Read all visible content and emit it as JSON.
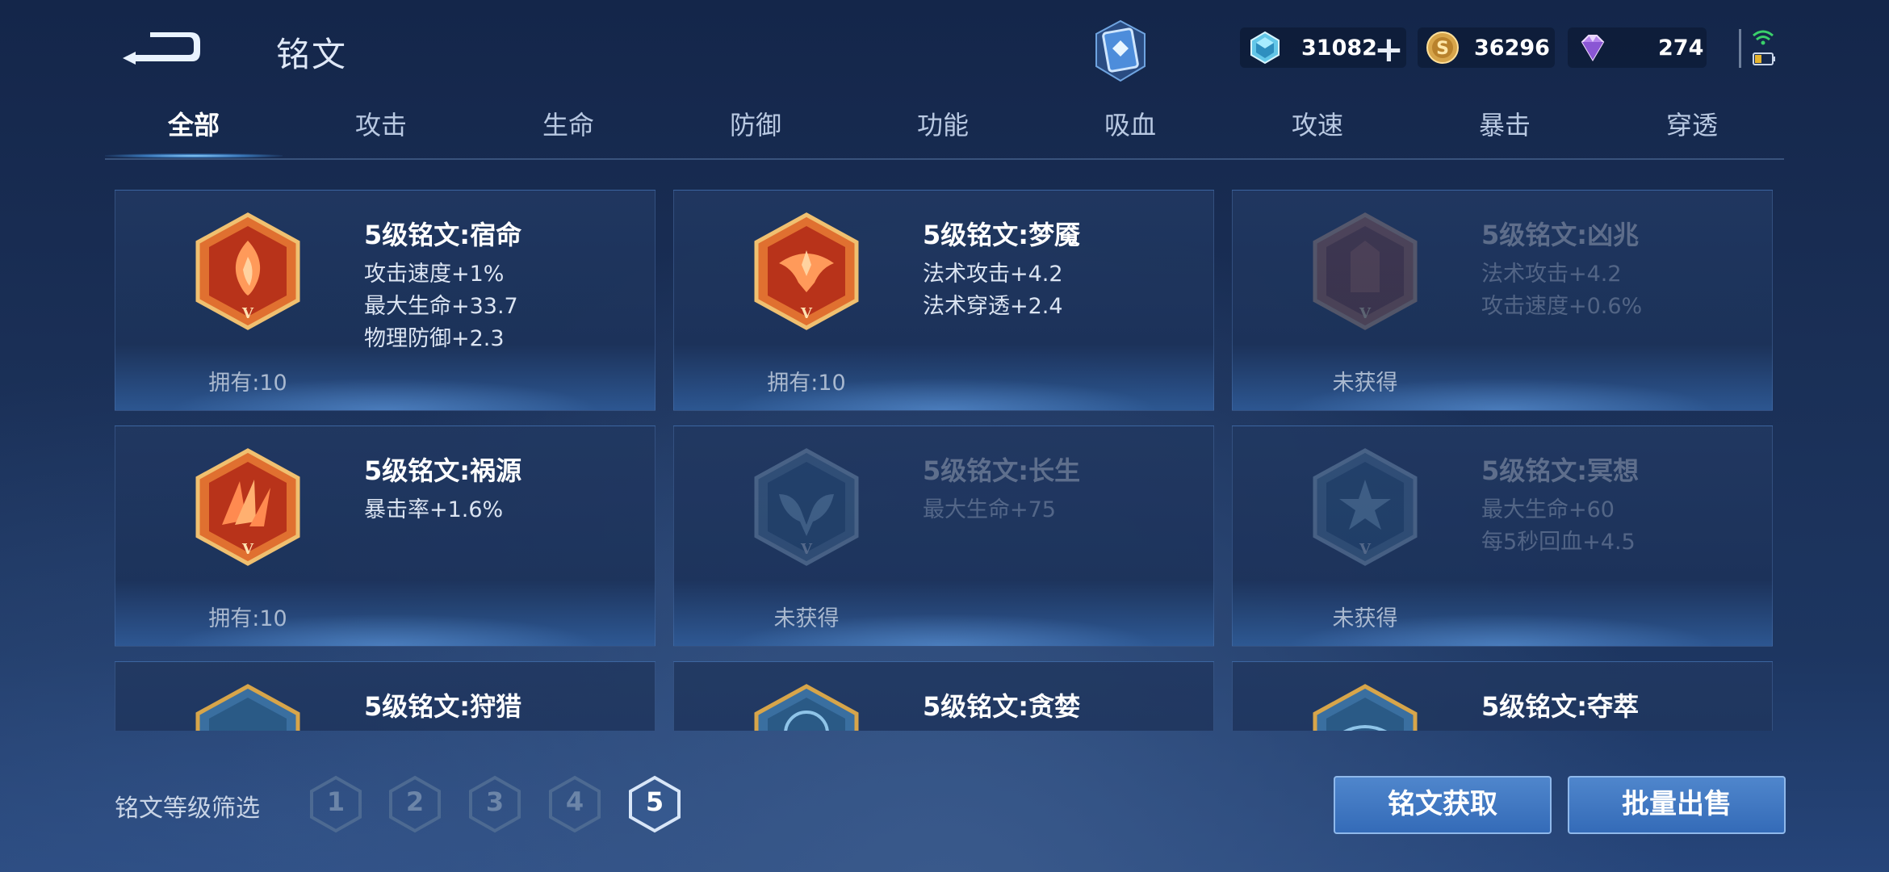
{
  "header": {
    "title": "铭文",
    "currencies": [
      {
        "name": "crystal-currency",
        "value": "31082",
        "icon": "crystal-icon",
        "has_plus": true
      },
      {
        "name": "gold-currency",
        "value": "36296",
        "icon": "gold-coin-icon",
        "has_plus": false
      },
      {
        "name": "diamond-currency",
        "value": "274",
        "icon": "diamond-icon",
        "has_plus": false
      }
    ],
    "plus_symbol": "+"
  },
  "tabs": [
    "全部",
    "攻击",
    "生命",
    "防御",
    "功能",
    "吸血",
    "攻速",
    "暴击",
    "穿透"
  ],
  "active_tab": "全部",
  "runes": [
    {
      "name": "5级铭文:宿命",
      "stats": [
        "攻击速度+1%",
        "最大生命+33.7",
        "物理防御+2.3"
      ],
      "owned": "拥有:10",
      "locked": false,
      "color": "#c8401c"
    },
    {
      "name": "5级铭文:梦魇",
      "stats": [
        "法术攻击+4.2",
        "法术穿透+2.4"
      ],
      "owned": "拥有:10",
      "locked": false,
      "color": "#c8401c"
    },
    {
      "name": "5级铭文:凶兆",
      "stats": [
        "法术攻击+4.2",
        "攻击速度+0.6%"
      ],
      "owned": "未获得",
      "locked": true,
      "color": "#a03a2a"
    },
    {
      "name": "5级铭文:祸源",
      "stats": [
        "暴击率+1.6%"
      ],
      "owned": "拥有:10",
      "locked": false,
      "color": "#c8401c"
    },
    {
      "name": "5级铭文:长生",
      "stats": [
        "最大生命+75"
      ],
      "owned": "未获得",
      "locked": true,
      "color": "#4a86b8"
    },
    {
      "name": "5级铭文:冥想",
      "stats": [
        "最大生命+60",
        "每5秒回血+4.5"
      ],
      "owned": "未获得",
      "locked": true,
      "color": "#4a86b8"
    },
    {
      "name": "5级铭文:狩猎",
      "stats": [],
      "owned": "",
      "locked": false,
      "color": "#3a78b0"
    },
    {
      "name": "5级铭文:贪婪",
      "stats": [],
      "owned": "",
      "locked": false,
      "color": "#3a78b0"
    },
    {
      "name": "5级铭文:夺萃",
      "stats": [],
      "owned": "",
      "locked": false,
      "color": "#3a78b0"
    }
  ],
  "footer": {
    "filter_label": "铭文等级筛选",
    "levels": [
      "1",
      "2",
      "3",
      "4",
      "5"
    ],
    "active_level": "5",
    "acquire_button": "铭文获取",
    "sell_button": "批量出售"
  },
  "colors": {
    "accent_blue": "#3a70ba",
    "rune_red": "#c8401c",
    "rune_gold": "#d7a54a"
  }
}
